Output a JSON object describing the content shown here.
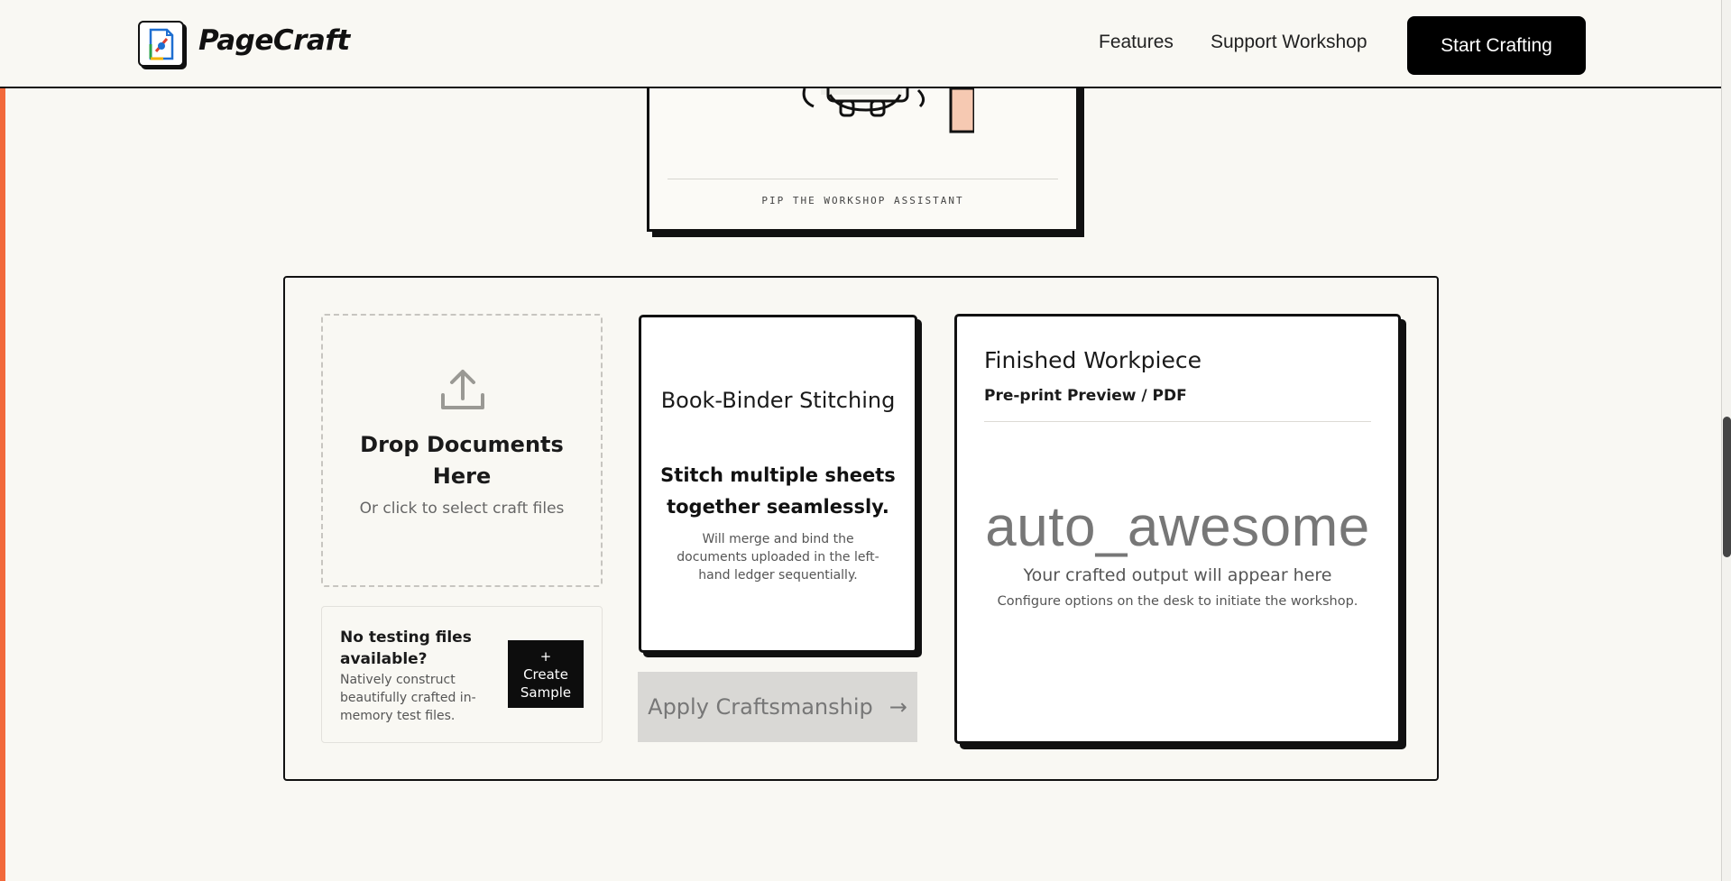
{
  "header": {
    "brand": "PageCraft",
    "nav": {
      "features": "Features",
      "support": "Support Workshop"
    },
    "cta": "Start Crafting"
  },
  "mascot": {
    "caption": "PIP THE WORKSHOP ASSISTANT"
  },
  "upload": {
    "title": "Drop Documents Here",
    "subtitle": "Or click to select craft files",
    "icon": "upload-icon"
  },
  "sample": {
    "title": "No testing files available?",
    "description": "Natively construct beautifully crafted in-memory test files.",
    "button_plus": "+",
    "button_label": "Create Sample"
  },
  "tool": {
    "title": "Book-Binder Stitching",
    "headline": "Stitch multiple sheets together seamlessly.",
    "description": "Will merge and bind the documents uploaded in the left-hand ledger sequentially."
  },
  "apply": {
    "label": "Apply Craftsmanship",
    "arrow": "→"
  },
  "output": {
    "title": "Finished Workpiece",
    "subtitle": "Pre-print Preview / PDF",
    "icon_text": "auto_awesome",
    "message": "Your crafted output will appear here",
    "hint": "Configure options on the desk to initiate the workshop."
  },
  "colors": {
    "accent": "#f2693a",
    "background": "#f9f8f3",
    "ink": "#111111",
    "disabled": "#d9d8d5"
  }
}
